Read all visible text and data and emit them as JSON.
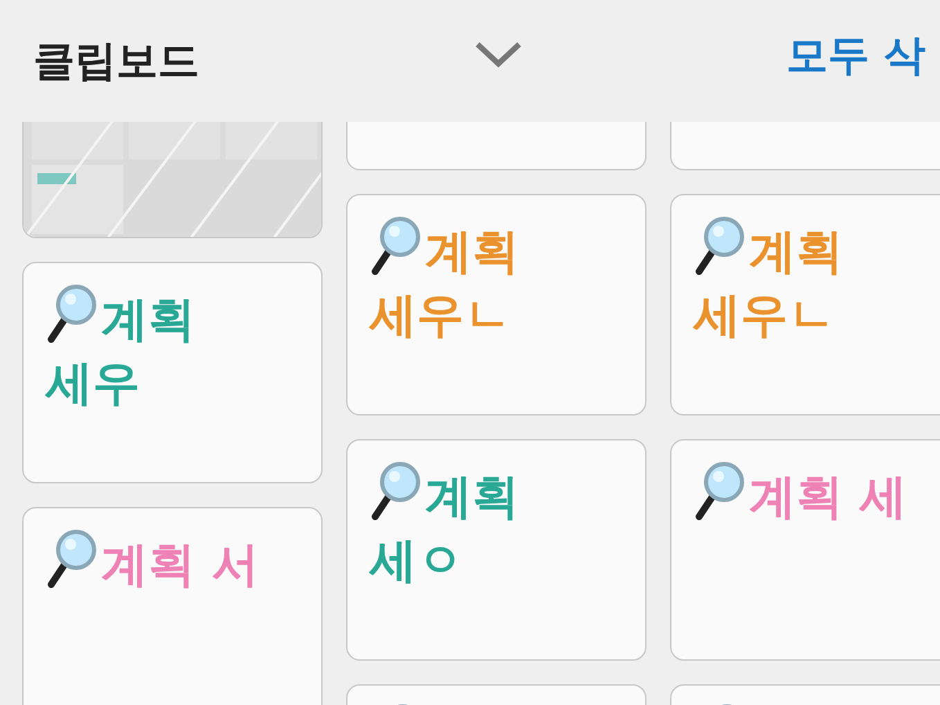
{
  "header": {
    "title": "클립보드",
    "clear_all": "모두 삭"
  },
  "columns": [
    {
      "cards": [
        {
          "kind": "picture"
        },
        {
          "kind": "note",
          "text": "계획 세우",
          "color": "#2aa896"
        },
        {
          "kind": "note",
          "text": "계획 서",
          "color": "#ee82b4"
        }
      ]
    },
    {
      "cards": [
        {
          "kind": "blank"
        },
        {
          "kind": "note",
          "text": "계획 세우ㄴ",
          "color": "#ea922e"
        },
        {
          "kind": "note",
          "text": "계획 세ㅇ",
          "color": "#2aa896"
        },
        {
          "kind": "icon_only"
        }
      ]
    },
    {
      "cards": [
        {
          "kind": "blank"
        },
        {
          "kind": "note",
          "text": "계획 세우ㄴ",
          "color": "#ea922e"
        },
        {
          "kind": "note",
          "text": "계획 세",
          "color": "#ee82b4"
        },
        {
          "kind": "icon_only"
        }
      ]
    }
  ]
}
